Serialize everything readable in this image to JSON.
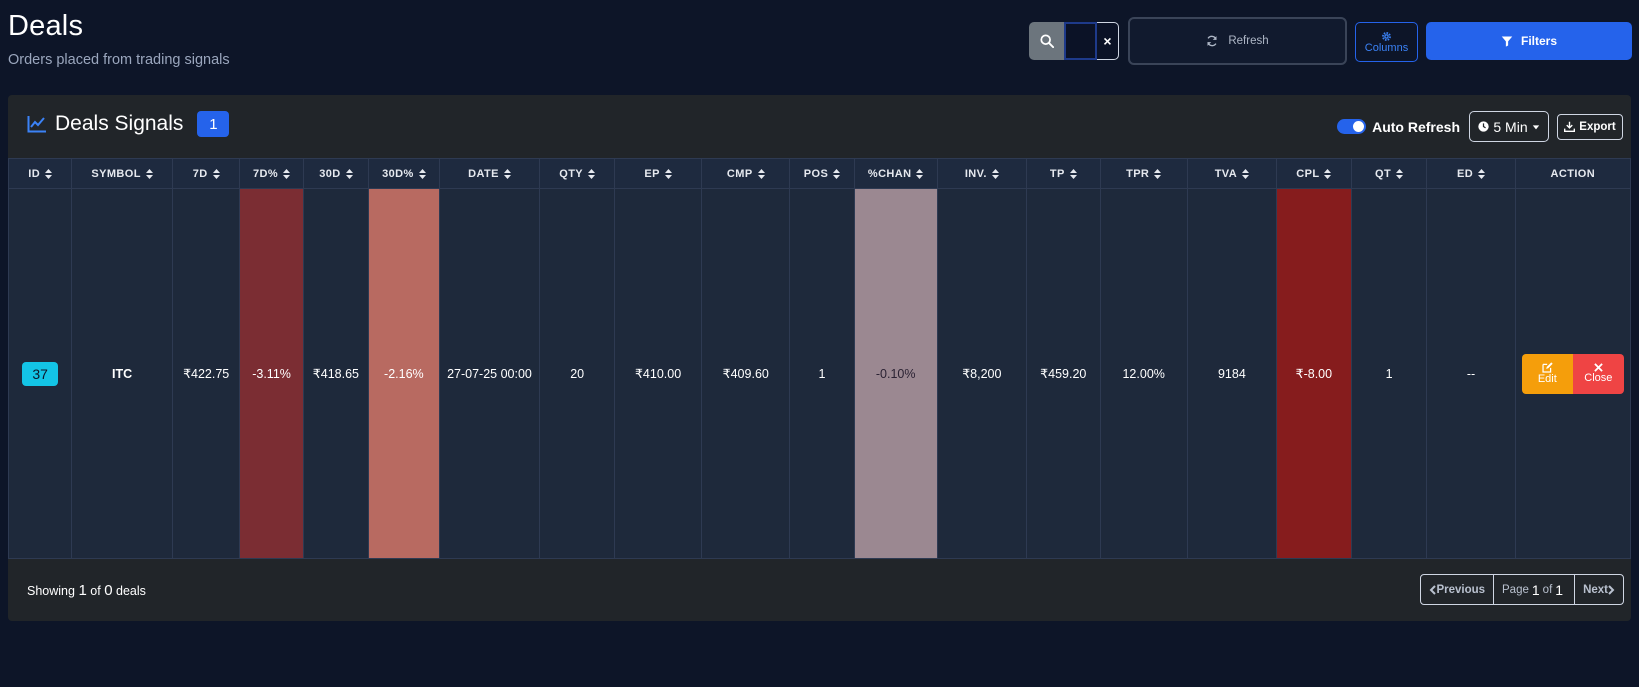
{
  "header": {
    "title": "Deals",
    "subtitle": "Orders placed from trading signals"
  },
  "toolbar": {
    "search_value": "",
    "refresh_label": "Refresh",
    "columns_label": "Columns",
    "filters_label": "Filters",
    "clear_label": "×"
  },
  "card": {
    "title": "Deals Signals",
    "count": "1",
    "auto_refresh_label": "Auto Refresh",
    "auto_refresh_on": true,
    "interval_label": "5 Min",
    "export_label": "Export"
  },
  "table": {
    "columns": [
      "ID",
      "SYMBOL",
      "7D",
      "7D%",
      "30D",
      "30D%",
      "DATE",
      "QTY",
      "EP",
      "CMP",
      "POS",
      "%CHAN",
      "INV.",
      "TP",
      "TPR",
      "TVA",
      "CPL",
      "QT",
      "ED",
      "ACTION"
    ],
    "rows": [
      {
        "id": "37",
        "symbol": "ITC",
        "d7": "₹422.75",
        "d7p": "-3.11%",
        "d30": "₹418.65",
        "d30p": "-2.16%",
        "date": "27-07-25 00:00",
        "qty": "20",
        "ep": "₹410.00",
        "cmp": "₹409.60",
        "pos": "1",
        "chan": "-0.10%",
        "inv": "₹8,200",
        "tp": "₹459.20",
        "tpr": "12.00%",
        "tva": "9184",
        "cpl": "₹-8.00",
        "qt": "1",
        "ed": "--",
        "edit_label": "Edit",
        "close_label": "Close"
      }
    ]
  },
  "footer": {
    "showing_prefix": "Showing",
    "showing_from": "1",
    "showing_of": "of",
    "showing_total": "0",
    "showing_suffix": "deals",
    "prev_label": "Previous",
    "page_label": "Page",
    "page_current": "1",
    "page_of": "of",
    "page_total": "1",
    "next_label": "Next"
  },
  "colors": {
    "background": "#0d1528",
    "card": "#212529",
    "accent": "#2563eb",
    "id_badge": "#13c4e6",
    "edit": "#f59e0b",
    "close": "#ef4444",
    "neg_7d": "#7b2d33",
    "neg_30d": "#b86a61",
    "chan": "#9b8891",
    "cpl": "#861c1d"
  }
}
